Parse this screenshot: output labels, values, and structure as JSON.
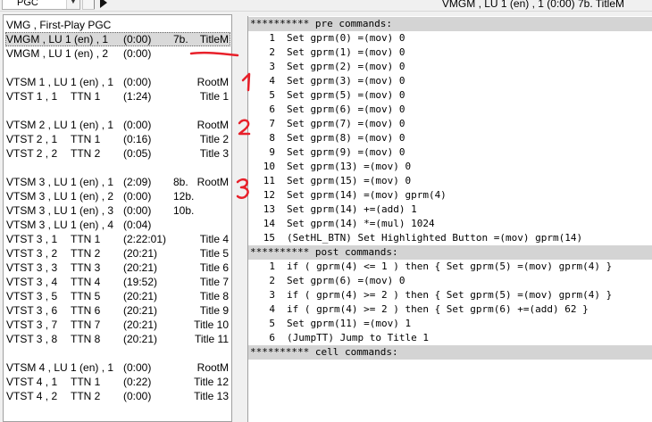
{
  "toolbar": {
    "pgc_select": "PGC",
    "title_info": "VMGM , LU 1 (en) , 1  (0:00)  7b.  TitleM"
  },
  "tree": {
    "rows": [
      {
        "c1": "VMG , First-Play PGC",
        "c2": "",
        "c3": "",
        "c4": "",
        "c5": ""
      },
      {
        "c1": "VMGM , LU 1 (en) , 1",
        "c2": "",
        "c3": "(0:00)",
        "c4": "7b.",
        "c5": "TitleM"
      },
      {
        "c1": "VMGM , LU 1 (en) , 2",
        "c2": "",
        "c3": "(0:00)",
        "c4": "",
        "c5": ""
      },
      {
        "c1": "",
        "c2": "",
        "c3": "",
        "c4": "",
        "c5": ""
      },
      {
        "c1": "VTSM 1 , LU 1 (en) , 1",
        "c2": "",
        "c3": "(0:00)",
        "c4": "",
        "c5": "RootM"
      },
      {
        "c1": "VTST 1 , 1",
        "c2": "TTN 1",
        "c3": "(1:24)",
        "c4": "",
        "c5": "Title 1"
      },
      {
        "c1": "",
        "c2": "",
        "c3": "",
        "c4": "",
        "c5": ""
      },
      {
        "c1": "VTSM 2 , LU 1 (en) , 1",
        "c2": "",
        "c3": "(0:00)",
        "c4": "",
        "c5": "RootM"
      },
      {
        "c1": "VTST 2 , 1",
        "c2": "TTN 1",
        "c3": "(0:16)",
        "c4": "",
        "c5": "Title 2"
      },
      {
        "c1": "VTST 2 , 2",
        "c2": "TTN 2",
        "c3": "(0:05)",
        "c4": "",
        "c5": "Title 3"
      },
      {
        "c1": "",
        "c2": "",
        "c3": "",
        "c4": "",
        "c5": ""
      },
      {
        "c1": "VTSM 3 , LU 1 (en) , 1",
        "c2": "",
        "c3": "(2:09)",
        "c4": "8b.",
        "c5": "RootM"
      },
      {
        "c1": "VTSM 3 , LU 1 (en) , 2",
        "c2": "",
        "c3": "(0:00)",
        "c4": "12b.",
        "c5": ""
      },
      {
        "c1": "VTSM 3 , LU 1 (en) , 3",
        "c2": "",
        "c3": "(0:00)",
        "c4": "10b.",
        "c5": ""
      },
      {
        "c1": "VTSM 3 , LU 1 (en) , 4",
        "c2": "",
        "c3": "(0:04)",
        "c4": "",
        "c5": ""
      },
      {
        "c1": "VTST 3 , 1",
        "c2": "TTN 1",
        "c3": "(2:22:01)",
        "c4": "",
        "c5": "Title 4"
      },
      {
        "c1": "VTST 3 , 2",
        "c2": "TTN 2",
        "c3": "(20:21)",
        "c4": "",
        "c5": "Title 5"
      },
      {
        "c1": "VTST 3 , 3",
        "c2": "TTN 3",
        "c3": "(20:21)",
        "c4": "",
        "c5": "Title 6"
      },
      {
        "c1": "VTST 3 , 4",
        "c2": "TTN 4",
        "c3": "(19:52)",
        "c4": "",
        "c5": "Title 7"
      },
      {
        "c1": "VTST 3 , 5",
        "c2": "TTN 5",
        "c3": "(20:21)",
        "c4": "",
        "c5": "Title 8"
      },
      {
        "c1": "VTST 3 , 6",
        "c2": "TTN 6",
        "c3": "(20:21)",
        "c4": "",
        "c5": "Title 9"
      },
      {
        "c1": "VTST 3 , 7",
        "c2": "TTN 7",
        "c3": "(20:21)",
        "c4": "",
        "c5": "Title 10"
      },
      {
        "c1": "VTST 3 , 8",
        "c2": "TTN 8",
        "c3": "(20:21)",
        "c4": "",
        "c5": "Title 11"
      },
      {
        "c1": "",
        "c2": "",
        "c3": "",
        "c4": "",
        "c5": ""
      },
      {
        "c1": "VTSM 4 , LU 1 (en) , 1",
        "c2": "",
        "c3": "(0:00)",
        "c4": "",
        "c5": "RootM"
      },
      {
        "c1": "VTST 4 , 1",
        "c2": "TTN 1",
        "c3": "(0:22)",
        "c4": "",
        "c5": "Title 12"
      },
      {
        "c1": "VTST 4 , 2",
        "c2": "TTN 2",
        "c3": "(0:00)",
        "c4": "",
        "c5": "Title 13"
      }
    ]
  },
  "commands": {
    "lines": [
      {
        "header": true,
        "text": "********** pre commands:"
      },
      {
        "num": "1",
        "text": "Set gprm(0) =(mov) 0"
      },
      {
        "num": "2",
        "text": "Set gprm(1) =(mov) 0"
      },
      {
        "num": "3",
        "text": "Set gprm(2) =(mov) 0"
      },
      {
        "num": "4",
        "text": "Set gprm(3) =(mov) 0"
      },
      {
        "num": "5",
        "text": "Set gprm(5) =(mov) 0"
      },
      {
        "num": "6",
        "text": "Set gprm(6) =(mov) 0"
      },
      {
        "num": "7",
        "text": "Set gprm(7) =(mov) 0"
      },
      {
        "num": "8",
        "text": "Set gprm(8) =(mov) 0"
      },
      {
        "num": "9",
        "text": "Set gprm(9) =(mov) 0"
      },
      {
        "num": "10",
        "text": "Set gprm(13) =(mov) 0"
      },
      {
        "num": "11",
        "text": "Set gprm(15) =(mov) 0"
      },
      {
        "num": "12",
        "text": "Set gprm(14) =(mov) gprm(4)"
      },
      {
        "num": "13",
        "text": "Set gprm(14) +=(add) 1"
      },
      {
        "num": "14",
        "text": "Set gprm(14) *=(mul) 1024"
      },
      {
        "num": "15",
        "text": "(SetHL_BTN) Set Highlighted Button =(mov) gprm(14)"
      },
      {
        "header": true,
        "text": "********** post commands:"
      },
      {
        "num": "1",
        "text": "if ( gprm(4) <= 1 ) then { Set gprm(5) =(mov) gprm(4) }"
      },
      {
        "num": "2",
        "text": "Set gprm(6) =(mov) 0"
      },
      {
        "num": "3",
        "text": "if ( gprm(4) >= 2 ) then { Set gprm(5) =(mov) gprm(4) }"
      },
      {
        "num": "4",
        "text": "if ( gprm(4) >= 2 ) then { Set gprm(6) +=(add) 62 }"
      },
      {
        "num": "5",
        "text": "Set gprm(11) =(mov) 1"
      },
      {
        "num": "6",
        "text": "(JumpTT) Jump to Title 1"
      },
      {
        "header": true,
        "text": "********** cell commands:"
      }
    ]
  },
  "annotations": {
    "color": "#e8202a",
    "marks": [
      "1",
      "2",
      "3"
    ]
  }
}
